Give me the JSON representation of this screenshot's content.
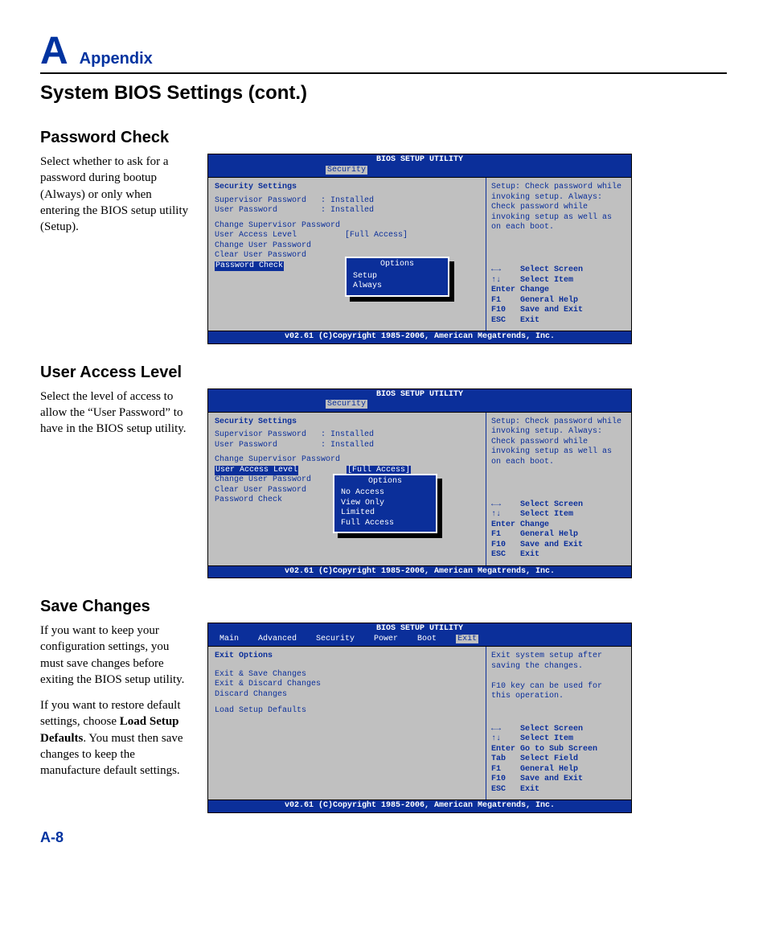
{
  "header": {
    "letter": "A",
    "label": "Appendix"
  },
  "page_title": "System BIOS Settings (cont.)",
  "page_number": "A-8",
  "s1": {
    "heading": "Password Check",
    "desc": "Select whether to ask for a password during bootup (Always) or only when entering the BIOS setup utility (Setup).",
    "bios": {
      "title": "BIOS SETUP UTILITY",
      "tab_selected": "Security",
      "left_heading": "Security Settings",
      "rows": {
        "r1": "Supervisor Password   : Installed",
        "r2": "User Password         : Installed",
        "r3": "Change Supervisor Password",
        "r4": "User Access Level          [Full Access]",
        "r5": "Change User Password",
        "r6": "Clear User Password",
        "r7_sel": "Password Check"
      },
      "popup": {
        "title": "Options",
        "opt1": "Setup",
        "opt2": "Always"
      },
      "help": "Setup: Check password while invoking setup. Always: Check password while invoking setup as well as on each boot.",
      "keys": "←→    Select Screen\n↑↓    Select Item\nEnter Change\nF1    General Help\nF10   Save and Exit\nESC   Exit",
      "footer": "v02.61 (C)Copyright 1985-2006, American Megatrends, Inc."
    }
  },
  "s2": {
    "heading": "User Access Level",
    "desc": "Select the level of access to allow the “User Pass­word” to have in the BIOS setup utility.",
    "bios": {
      "title": "BIOS SETUP UTILITY",
      "tab_selected": "Security",
      "left_heading": "Security Settings",
      "rows": {
        "r1": "Supervisor Password   : Installed",
        "r2": "User Password         : Installed",
        "r3": "Change Supervisor Password",
        "r4_sel_l": "User Access Level",
        "r4_sel_r": "[Full Access]",
        "r5": "Change User Password",
        "r6": "Clear User Password",
        "r7": "Password Check"
      },
      "popup": {
        "title": "Options",
        "opt1": "No Access",
        "opt2": "View Only",
        "opt3": "Limited",
        "opt4": "Full Access"
      },
      "help": "Setup: Check password while invoking setup. Always: Check password while invoking setup as well as on each boot.",
      "keys": "←→    Select Screen\n↑↓    Select Item\nEnter Change\nF1    General Help\nF10   Save and Exit\nESC   Exit",
      "footer": "v02.61 (C)Copyright 1985-2006, American Megatrends, Inc."
    }
  },
  "s3": {
    "heading": "Save Changes",
    "desc1": "If you want to keep your configuration settings, you must save changes before exiting the BIOS setup utility.",
    "desc2a": "If you want to restore default settings, choose ",
    "desc2b_bold": "Load Setup Defaults",
    "desc2c": ". You must then save changes to keep the manufacture default settings.",
    "bios": {
      "title": "BIOS SETUP UTILITY",
      "tabs": "Main    Advanced    Security    Power    Boot   ",
      "tab_selected": "Exit",
      "left_heading": "Exit Options",
      "rows": {
        "r1": "Exit & Save Changes",
        "r2": "Exit & Discard Changes",
        "r3": "Discard Changes",
        "r4": "Load Setup Defaults"
      },
      "help": "Exit system setup after saving the changes.\n\nF10 key can be used for this operation.",
      "keys": "←→    Select Screen\n↑↓    Select Item\nEnter Go to Sub Screen\nTab   Select Field\nF1    General Help\nF10   Save and Exit\nESC   Exit",
      "footer": "v02.61 (C)Copyright 1985-2006, American Megatrends, Inc."
    }
  }
}
